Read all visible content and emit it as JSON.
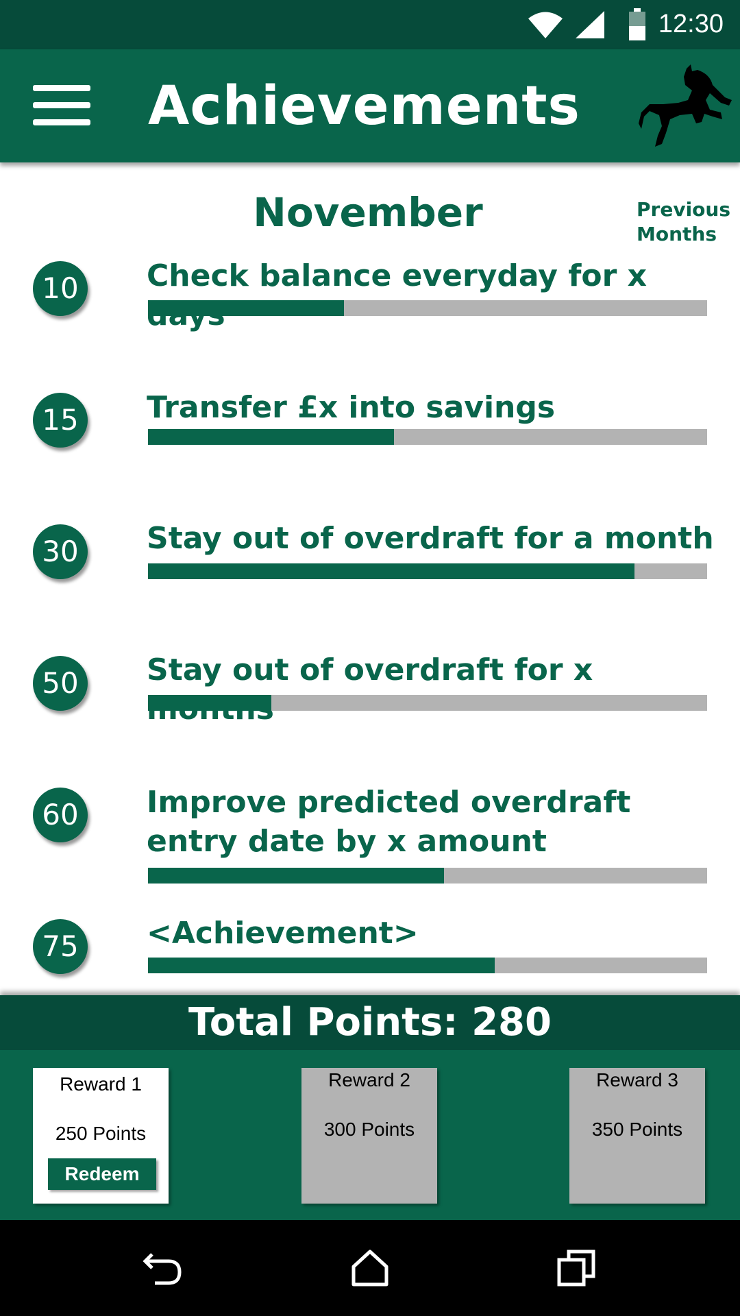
{
  "status_bar": {
    "time": "12:30",
    "icons": [
      "wifi-icon",
      "signal-icon",
      "battery-icon"
    ]
  },
  "app_bar": {
    "title": "Achievements",
    "menu_icon": "hamburger-menu-icon",
    "logo": "black-horse-logo"
  },
  "header": {
    "month": "November",
    "previous_months": "Previous Months"
  },
  "achievements": [
    {
      "points": "10",
      "label": "Check balance everyday for x days",
      "progress": 0.35
    },
    {
      "points": "15",
      "label": "Transfer £x into savings",
      "progress": 0.44
    },
    {
      "points": "30",
      "label": "Stay out of overdraft for a month",
      "progress": 0.87
    },
    {
      "points": "50",
      "label": "Stay out of overdraft for x months",
      "progress": 0.22
    },
    {
      "points": "60",
      "label": "Improve predicted overdraft entry date by x amount",
      "progress": 0.53
    },
    {
      "points": "75",
      "label": "<Achievement>",
      "progress": 0.62
    }
  ],
  "total": {
    "text": "Total Points: 280"
  },
  "rewards": [
    {
      "name": "Reward 1",
      "points": "250 Points",
      "action": "Redeem",
      "available": true
    },
    {
      "name": "Reward 2",
      "points": "300 Points",
      "available": false
    },
    {
      "name": "Reward 3",
      "points": "350 Points",
      "available": false
    }
  ],
  "nav_bar": {
    "icons": [
      "back-icon",
      "home-icon",
      "recents-icon"
    ]
  },
  "colors": {
    "primary": "#09654b",
    "dark": "#064b3a",
    "track": "#b3b3b3"
  }
}
